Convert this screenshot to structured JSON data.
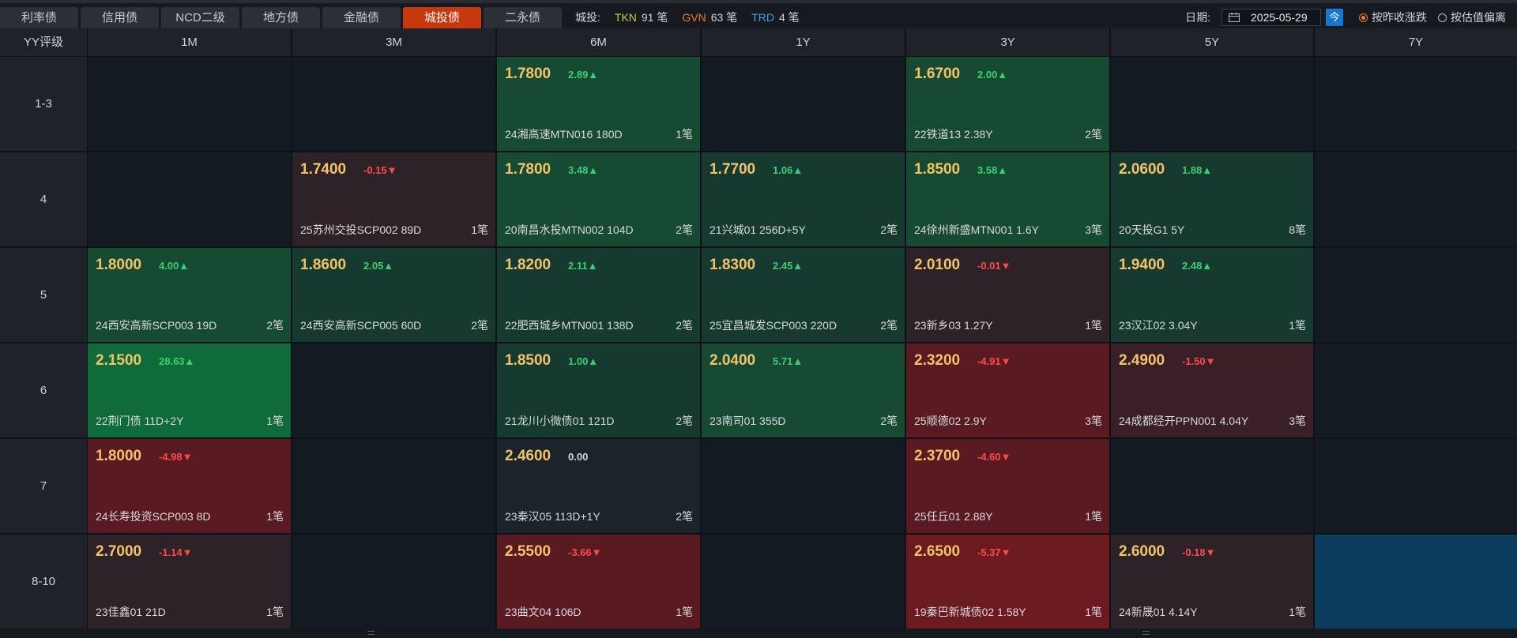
{
  "tabs": [
    "利率债",
    "信用债",
    "NCD二级",
    "地方债",
    "金融债",
    "城投债",
    "二永债"
  ],
  "active_tab": 5,
  "summary": {
    "label": "城投:",
    "items": [
      {
        "code": "TKN",
        "count": "91 笔",
        "color": "#c7cf2e"
      },
      {
        "code": "GVN",
        "count": "63 笔",
        "color": "#f0763a"
      },
      {
        "code": "TRD",
        "count": "4 笔",
        "color": "#3aa0f0"
      }
    ]
  },
  "date": {
    "label": "日期:",
    "value": "2025-05-29",
    "today_label": "今"
  },
  "radios": [
    {
      "label": "按昨收涨跌",
      "checked": true
    },
    {
      "label": "按估值偏离",
      "checked": false
    }
  ],
  "colors": {
    "empty": "#141a21",
    "dark_green": "#173a30",
    "mid_green": "#174a33",
    "bright_green": "#0f6b3a",
    "flat": "#1c232b",
    "light_red": "#2c2228",
    "mid_red": "#3a1f27",
    "dark_red": "#5a1a22",
    "bright_red": "#6b1a20",
    "selected": "#0b3e5e"
  },
  "grid": {
    "corner": "YY评级",
    "columns": [
      "1M",
      "3M",
      "6M",
      "1Y",
      "3Y",
      "5Y",
      "7Y"
    ],
    "rows": [
      {
        "label": "1-3",
        "cells": [
          null,
          null,
          {
            "price": "1.7800",
            "change": "2.89▲",
            "dir": "up",
            "bond": "24湘高速MTN016 180D",
            "count": "1笔",
            "tone": "mid_green"
          },
          null,
          {
            "price": "1.6700",
            "change": "2.00▲",
            "dir": "up",
            "bond": "22铁道13 2.38Y",
            "count": "2笔",
            "tone": "mid_green"
          },
          null,
          null
        ]
      },
      {
        "label": "4",
        "cells": [
          null,
          {
            "price": "1.7400",
            "change": "-0.15▼",
            "dir": "down",
            "bond": "25苏州交投SCP002 89D",
            "count": "1笔",
            "tone": "light_red"
          },
          {
            "price": "1.7800",
            "change": "3.48▲",
            "dir": "up",
            "bond": "20南昌水投MTN002 104D",
            "count": "2笔",
            "tone": "mid_green"
          },
          {
            "price": "1.7700",
            "change": "1.06▲",
            "dir": "up",
            "bond": "21兴城01 256D+5Y",
            "count": "2笔",
            "tone": "dark_green"
          },
          {
            "price": "1.8500",
            "change": "3.58▲",
            "dir": "up",
            "bond": "24徐州新盛MTN001 1.6Y",
            "count": "3笔",
            "tone": "mid_green"
          },
          {
            "price": "2.0600",
            "change": "1.88▲",
            "dir": "up",
            "bond": "20天投G1 5Y",
            "count": "8笔",
            "tone": "dark_green"
          },
          null
        ]
      },
      {
        "label": "5",
        "cells": [
          {
            "price": "1.8000",
            "change": "4.00▲",
            "dir": "up",
            "bond": "24西安高新SCP003 19D",
            "count": "2笔",
            "tone": "mid_green"
          },
          {
            "price": "1.8600",
            "change": "2.05▲",
            "dir": "up",
            "bond": "24西安高新SCP005 60D",
            "count": "2笔",
            "tone": "dark_green"
          },
          {
            "price": "1.8200",
            "change": "2.11▲",
            "dir": "up",
            "bond": "22肥西城乡MTN001 138D",
            "count": "2笔",
            "tone": "dark_green"
          },
          {
            "price": "1.8300",
            "change": "2.45▲",
            "dir": "up",
            "bond": "25宜昌城发SCP003 220D",
            "count": "2笔",
            "tone": "dark_green"
          },
          {
            "price": "2.0100",
            "change": "-0.01▼",
            "dir": "down",
            "bond": "23新乡03 1.27Y",
            "count": "1笔",
            "tone": "light_red"
          },
          {
            "price": "1.9400",
            "change": "2.48▲",
            "dir": "up",
            "bond": "23汉江02 3.04Y",
            "count": "1笔",
            "tone": "dark_green"
          },
          null
        ]
      },
      {
        "label": "6",
        "cells": [
          {
            "price": "2.1500",
            "change": "28.63▲",
            "dir": "up",
            "bond": "22荆门债 11D+2Y",
            "count": "1笔",
            "tone": "bright_green"
          },
          null,
          {
            "price": "1.8500",
            "change": "1.00▲",
            "dir": "up",
            "bond": "21龙川小微债01 121D",
            "count": "2笔",
            "tone": "dark_green"
          },
          {
            "price": "2.0400",
            "change": "5.71▲",
            "dir": "up",
            "bond": "23南司01 355D",
            "count": "2笔",
            "tone": "mid_green"
          },
          {
            "price": "2.3200",
            "change": "-4.91▼",
            "dir": "down",
            "bond": "25顺德02 2.9Y",
            "count": "3笔",
            "tone": "dark_red"
          },
          {
            "price": "2.4900",
            "change": "-1.50▼",
            "dir": "down",
            "bond": "24成都经开PPN001 4.04Y",
            "count": "3笔",
            "tone": "mid_red"
          },
          null
        ]
      },
      {
        "label": "7",
        "cells": [
          {
            "price": "1.8000",
            "change": "-4.98▼",
            "dir": "down",
            "bond": "24长寿投资SCP003 8D",
            "count": "1笔",
            "tone": "dark_red"
          },
          null,
          {
            "price": "2.4600",
            "change": "0.00",
            "dir": "flat",
            "bond": "23秦汉05 113D+1Y",
            "count": "2笔",
            "tone": "flat"
          },
          null,
          {
            "price": "2.3700",
            "change": "-4.60▼",
            "dir": "down",
            "bond": "25任丘01 2.88Y",
            "count": "1笔",
            "tone": "dark_red"
          },
          null,
          null
        ]
      },
      {
        "label": "8-10",
        "cells": [
          {
            "price": "2.7000",
            "change": "-1.14▼",
            "dir": "down",
            "bond": "23佳鑫01 21D",
            "count": "1笔",
            "tone": "light_red"
          },
          null,
          {
            "price": "2.5500",
            "change": "-3.66▼",
            "dir": "down",
            "bond": "23曲文04 106D",
            "count": "1笔",
            "tone": "dark_red"
          },
          null,
          {
            "price": "2.6500",
            "change": "-5.37▼",
            "dir": "down",
            "bond": "19秦巴新城债02 1.58Y",
            "count": "1笔",
            "tone": "bright_red"
          },
          {
            "price": "2.6000",
            "change": "-0.18▼",
            "dir": "down",
            "bond": "24新晟01 4.14Y",
            "count": "1笔",
            "tone": "light_red"
          },
          {
            "selected": true
          }
        ]
      }
    ]
  }
}
